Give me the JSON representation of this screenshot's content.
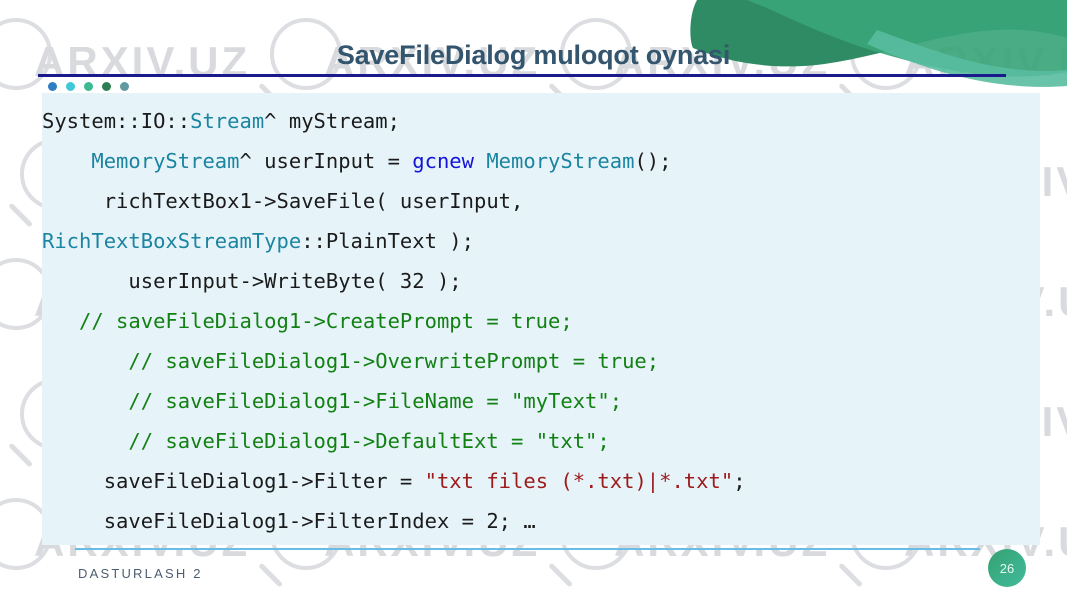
{
  "slide": {
    "title": "SaveFileDialog muloqot oynasi",
    "watermark_text": "ARXIV.UZ"
  },
  "decor": {
    "dots": [
      {
        "name": "dot-blue",
        "color": "#2e7ec4"
      },
      {
        "name": "dot-cyan",
        "color": "#3ec8d8"
      },
      {
        "name": "dot-teal",
        "color": "#3dba94"
      },
      {
        "name": "dot-green",
        "color": "#2e7d52"
      },
      {
        "name": "dot-gray-teal",
        "color": "#5e9aa0"
      }
    ],
    "rule_color": "#1a1a8c",
    "footer_rule_color": "#69bde4",
    "wave_color_dark": "#2e8b63",
    "wave_color_light": "#4cb894",
    "panel_bg": "#e6f4fa"
  },
  "code": {
    "language": "cpp-cli",
    "lines": [
      {
        "indent": 0,
        "tokens": [
          {
            "text": "System::IO::",
            "cls": "tok-plain"
          },
          {
            "text": "Stream",
            "cls": "tok-type"
          },
          {
            "text": "^ myStream;",
            "cls": "tok-plain"
          }
        ]
      },
      {
        "indent": 4,
        "tokens": [
          {
            "text": "MemoryStream",
            "cls": "tok-type"
          },
          {
            "text": "^ userInput = ",
            "cls": "tok-plain"
          },
          {
            "text": "gcnew",
            "cls": "tok-kw"
          },
          {
            "text": " ",
            "cls": "tok-plain"
          },
          {
            "text": "MemoryStream",
            "cls": "tok-type"
          },
          {
            "text": "();",
            "cls": "tok-plain"
          }
        ]
      },
      {
        "indent": 4,
        "tokens": [
          {
            "text": " richTextBox1->SaveFile( userInput,",
            "cls": "tok-plain"
          }
        ]
      },
      {
        "indent": 0,
        "tokens": [
          {
            "text": "RichTextBoxStreamType",
            "cls": "tok-type"
          },
          {
            "text": "::PlainText );",
            "cls": "tok-plain"
          }
        ]
      },
      {
        "indent": 6,
        "tokens": [
          {
            "text": " userInput->WriteByte( 32 );",
            "cls": "tok-plain"
          }
        ]
      },
      {
        "indent": 3,
        "tokens": [
          {
            "text": "// saveFileDialog1->CreatePrompt = true;",
            "cls": "tok-cmt"
          }
        ]
      },
      {
        "indent": 6,
        "tokens": [
          {
            "text": " // saveFileDialog1->OverwritePrompt = true;",
            "cls": "tok-cmt"
          }
        ]
      },
      {
        "indent": 6,
        "tokens": [
          {
            "text": " // saveFileDialog1->FileName = \"myText\";",
            "cls": "tok-cmt"
          }
        ]
      },
      {
        "indent": 6,
        "tokens": [
          {
            "text": " // saveFileDialog1->DefaultExt = \"txt\";",
            "cls": "tok-cmt"
          }
        ]
      },
      {
        "indent": 5,
        "tokens": [
          {
            "text": "saveFileDialog1->Filter = ",
            "cls": "tok-plain"
          },
          {
            "text": "\"txt files (*.txt)|*.txt\"",
            "cls": "tok-str"
          },
          {
            "text": ";",
            "cls": "tok-plain"
          }
        ]
      },
      {
        "indent": 5,
        "tokens": [
          {
            "text": "saveFileDialog1->FilterIndex = 2; …",
            "cls": "tok-plain"
          }
        ]
      }
    ]
  },
  "footer": {
    "label": "DASTURLASH 2",
    "page_number": "26"
  }
}
